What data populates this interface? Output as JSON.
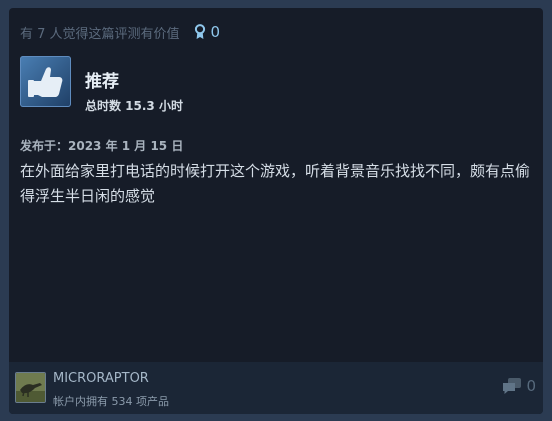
{
  "review": {
    "helpful_text": "有 7 人觉得这篇评测有价值",
    "award_count": "0",
    "recommendation": "推荐",
    "hours": "总时数 15.3 小时",
    "posted": "发布于：2023 年 1 月 15 日",
    "body": "在外面给家里打电话的时候打开这个游戏，听着背景音乐找找不同，颇有点偷得浮生半日闲的感觉"
  },
  "author": {
    "name": "MICRORAPTOR",
    "products_owned": "帐户内拥有 534 项产品"
  },
  "comments": {
    "count": "0"
  },
  "colors": {
    "page_bg": "#2b3b52",
    "card_bg": "#161c28",
    "footer_bg": "#1b2636",
    "award_accent": "#8fc7ec"
  },
  "icons": [
    "award-icon",
    "thumbs-up-icon",
    "comment-icon"
  ]
}
